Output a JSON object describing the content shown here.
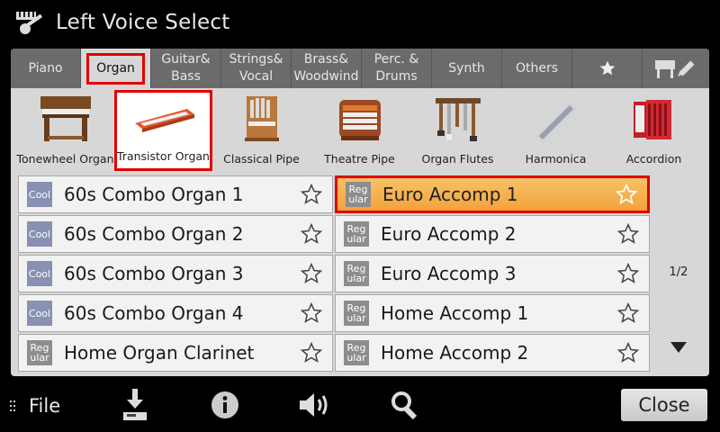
{
  "window": {
    "title": "Left Voice Select"
  },
  "tabs": [
    {
      "label": "Piano"
    },
    {
      "label": "Organ",
      "active": true
    },
    {
      "line1": "Guitar&",
      "line2": "Bass"
    },
    {
      "line1": "Strings&",
      "line2": "Vocal"
    },
    {
      "line1": "Brass&",
      "line2": "Woodwind"
    },
    {
      "line1": "Perc. &",
      "line2": "Drums"
    },
    {
      "label": "Synth"
    },
    {
      "label": "Others"
    },
    {
      "icon": "star-icon"
    },
    {
      "icon": "piano-edit-icon"
    }
  ],
  "subcategories": [
    {
      "label": "Tonewheel Organ",
      "icon": "tonewheel-organ-icon"
    },
    {
      "label": "Transistor Organ",
      "icon": "transistor-organ-icon",
      "active": true
    },
    {
      "label": "Classical Pipe",
      "icon": "classical-pipe-icon"
    },
    {
      "label": "Theatre Pipe",
      "icon": "theatre-pipe-icon"
    },
    {
      "label": "Organ Flutes",
      "icon": "organ-flutes-icon"
    },
    {
      "label": "Harmonica",
      "icon": "harmonica-icon"
    },
    {
      "label": "Accordion",
      "icon": "accordion-icon"
    }
  ],
  "voices": [
    {
      "badge_type": "cool",
      "badge_line1": "Cool",
      "badge_line2": "",
      "name": "60s Combo Organ 1"
    },
    {
      "badge_type": "cool",
      "badge_line1": "Cool",
      "badge_line2": "",
      "name": "60s Combo Organ 2"
    },
    {
      "badge_type": "cool",
      "badge_line1": "Cool",
      "badge_line2": "",
      "name": "60s Combo Organ 3"
    },
    {
      "badge_type": "cool",
      "badge_line1": "Cool",
      "badge_line2": "",
      "name": "60s Combo Organ 4"
    },
    {
      "badge_type": "regular",
      "badge_line1": "Reg",
      "badge_line2": "ular",
      "name": "Home Organ Clarinet"
    },
    {
      "badge_type": "regular",
      "badge_line1": "Reg",
      "badge_line2": "ular",
      "name": "Euro Accomp 1",
      "selected": true
    },
    {
      "badge_type": "regular",
      "badge_line1": "Reg",
      "badge_line2": "ular",
      "name": "Euro Accomp 2"
    },
    {
      "badge_type": "regular",
      "badge_line1": "Reg",
      "badge_line2": "ular",
      "name": "Euro Accomp 3"
    },
    {
      "badge_type": "regular",
      "badge_line1": "Reg",
      "badge_line2": "ular",
      "name": "Home Accomp 1"
    },
    {
      "badge_type": "regular",
      "badge_line1": "Reg",
      "badge_line2": "ular",
      "name": "Home Accomp 2"
    }
  ],
  "pager": {
    "page": "1/2"
  },
  "toolbar": {
    "file_label": "File",
    "close_label": "Close",
    "icons": [
      "save-icon",
      "info-icon",
      "speaker-icon",
      "search-icon"
    ]
  },
  "colors": {
    "selected_highlight": "#f2a23c",
    "selection_border": "#e00000",
    "cool_badge": "#8890b4",
    "regular_badge": "#8d8d8d",
    "tab_bar": "#6b6b6b"
  }
}
